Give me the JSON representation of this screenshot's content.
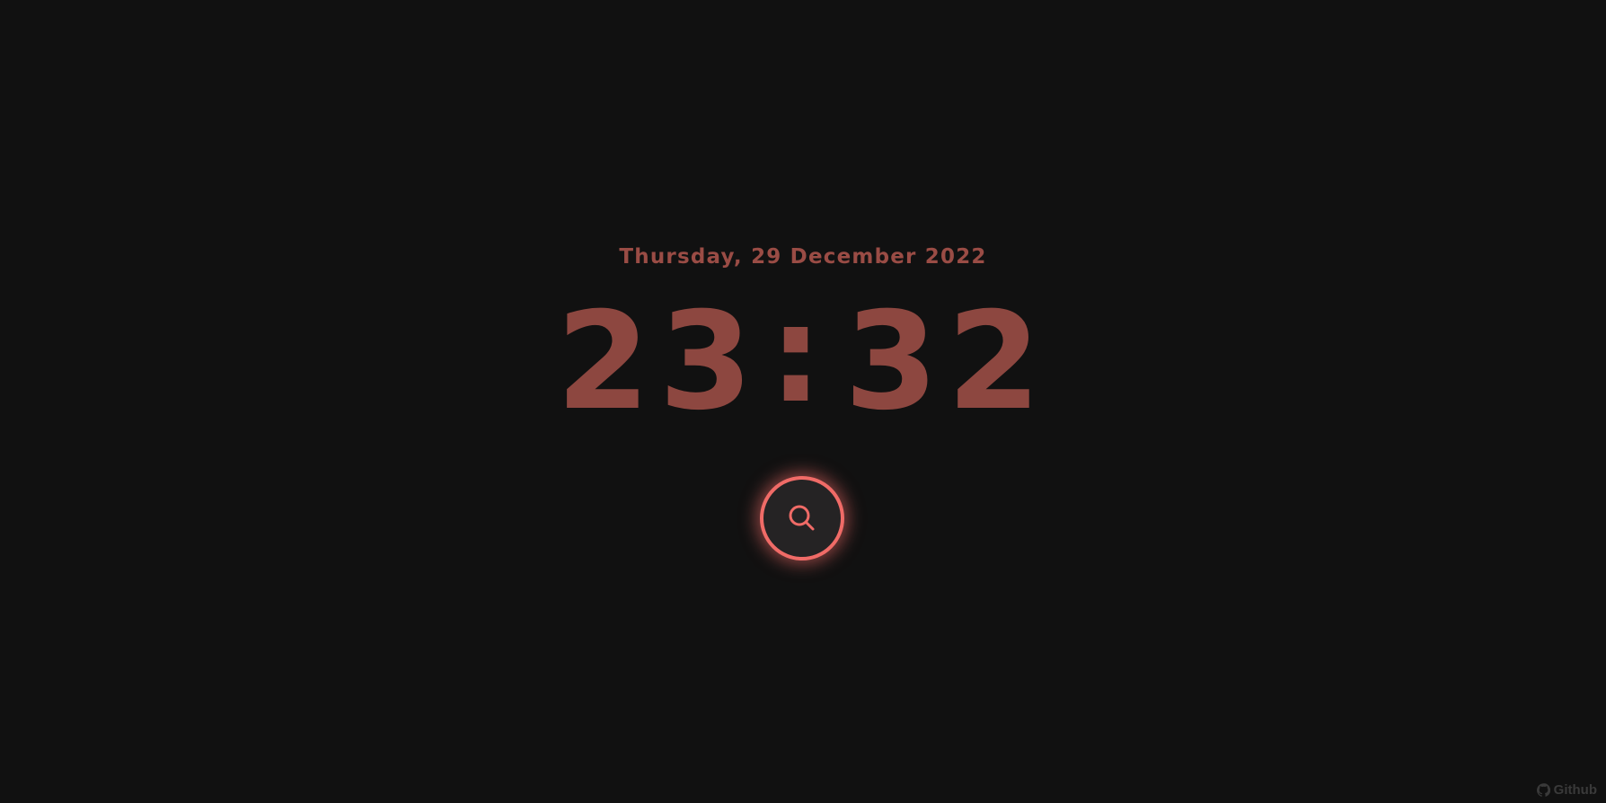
{
  "clock": {
    "date": "Thursday, 29 December 2022",
    "hours": "23",
    "separator": ":",
    "minutes": "32"
  },
  "search_button": {
    "icon": "search-icon"
  },
  "footer": {
    "github_label": "Github",
    "github_icon": "github-icon"
  },
  "colors": {
    "background": "#111111",
    "clock_text": "#8d4740",
    "date_text": "#9a4c45",
    "accent": "#f06b67",
    "button_fill": "#252324",
    "footer_text": "#3a3a3a"
  }
}
